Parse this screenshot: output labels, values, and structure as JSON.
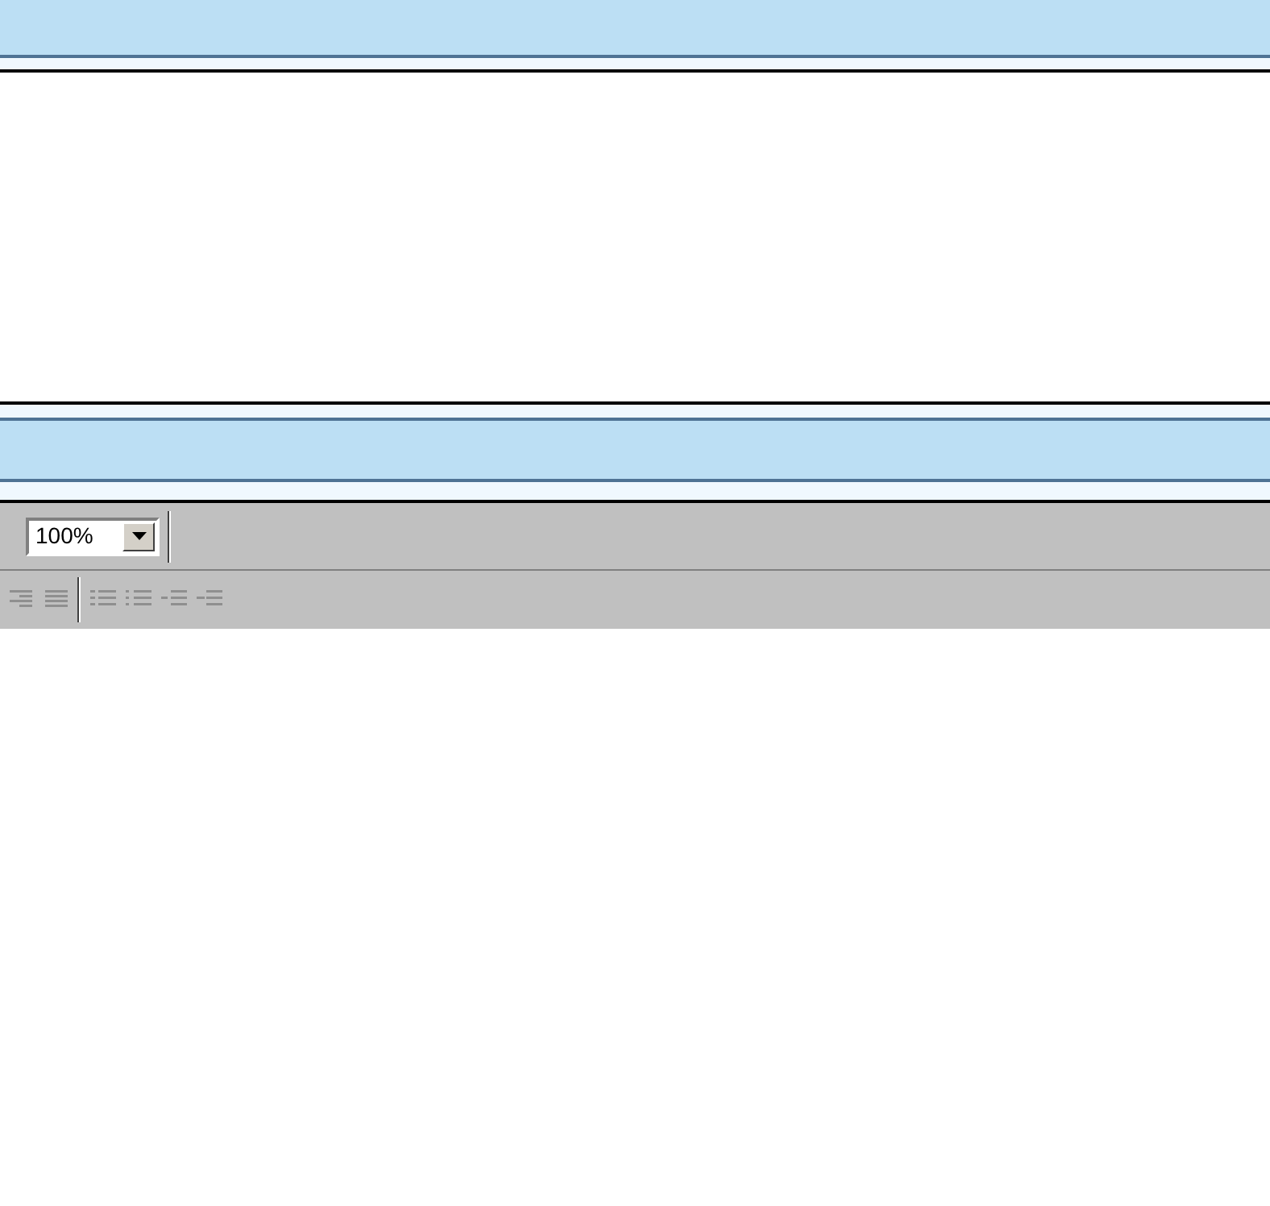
{
  "toolbar": {
    "zoom": {
      "value": "100%"
    }
  }
}
